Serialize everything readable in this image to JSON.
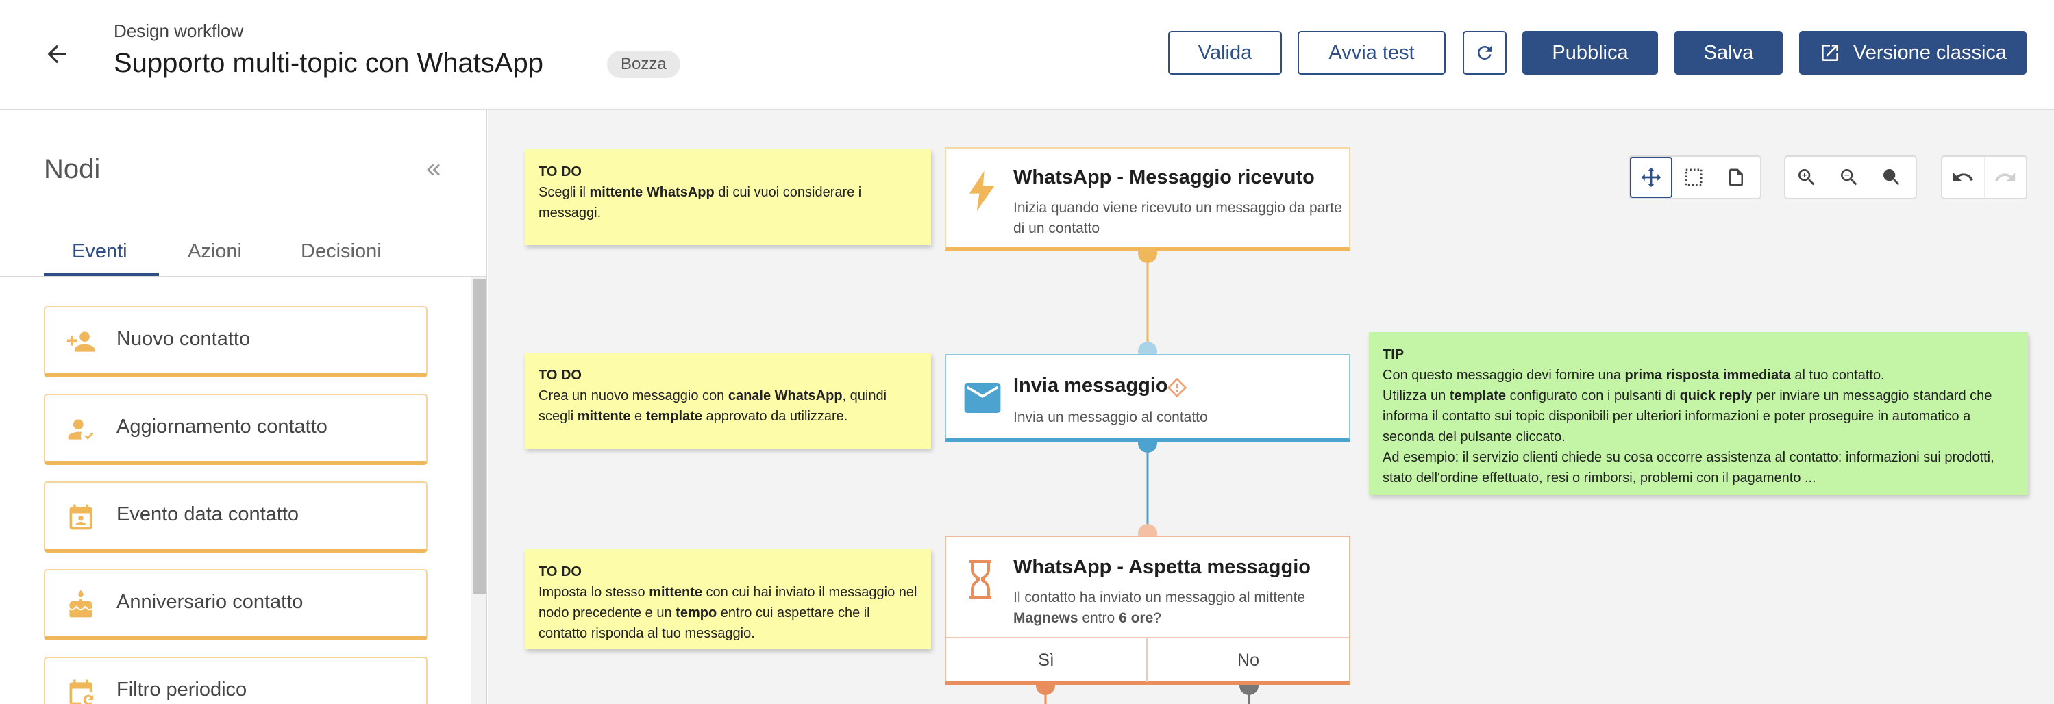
{
  "header": {
    "subtitle": "Design workflow",
    "title": "Supporto multi-topic con WhatsApp",
    "badge": "Bozza",
    "buttons": {
      "validate": "Valida",
      "start_test": "Avvia test",
      "publish": "Pubblica",
      "save": "Salva",
      "classic_version": "Versione classica"
    }
  },
  "sidebar": {
    "title": "Nodi",
    "tabs": [
      "Eventi",
      "Azioni",
      "Decisioni"
    ],
    "active_tab": "Eventi",
    "items": [
      {
        "label": "Nuovo contatto",
        "icon": "person-add-icon"
      },
      {
        "label": "Aggiornamento contatto",
        "icon": "person-check-icon"
      },
      {
        "label": "Evento data contatto",
        "icon": "calendar-person-icon"
      },
      {
        "label": "Anniversario contatto",
        "icon": "cake-icon"
      },
      {
        "label": "Filtro periodico",
        "icon": "calendar-refresh-icon"
      }
    ]
  },
  "canvas": {
    "notes": [
      {
        "title": "TO DO",
        "parts": [
          [
            "Scegli il ",
            false
          ],
          [
            "mittente WhatsApp",
            true
          ],
          [
            " di cui vuoi considerare i messaggi.",
            false
          ]
        ]
      },
      {
        "title": "TO DO",
        "parts": [
          [
            "Crea un nuovo messaggio con ",
            false
          ],
          [
            "canale WhatsApp",
            true
          ],
          [
            ", quindi scegli ",
            false
          ],
          [
            "mittente",
            true
          ],
          [
            " e ",
            false
          ],
          [
            "template",
            true
          ],
          [
            " approvato da utilizzare.",
            false
          ]
        ]
      },
      {
        "title": "TO DO",
        "parts": [
          [
            "Imposta lo stesso ",
            false
          ],
          [
            "mittente",
            true
          ],
          [
            " con cui hai inviato il messaggio nel nodo precedente e un ",
            false
          ],
          [
            "tempo",
            true
          ],
          [
            " entro cui aspettare che il contatto risponda al tuo messaggio.",
            false
          ]
        ]
      },
      {
        "title": "TIP",
        "parts": [
          [
            "Con questo messaggio devi fornire una ",
            false
          ],
          [
            "prima risposta immediata",
            true
          ],
          [
            " al tuo contatto.\nUtilizza un ",
            false
          ],
          [
            "template",
            true
          ],
          [
            " configurato con i pulsanti di ",
            false
          ],
          [
            "quick reply",
            true
          ],
          [
            " per inviare un messaggio standard che informa il contatto sui topic disponibili per ulteriori informazioni e poter proseguire in automatico a seconda del pulsante cliccato.\nAd esempio: il servizio clienti chiede su cosa occorre assistenza al contatto: informazioni sui prodotti, stato dell'ordine effettuato, resi o rimborsi, problemi con il pagamento ...",
            false
          ]
        ]
      }
    ],
    "nodes": {
      "received": {
        "title": "WhatsApp - Messaggio ricevuto",
        "desc": "Inizia quando viene ricevuto un messaggio da parte di un contatto",
        "icon": "lightning-icon",
        "color": "#f0b75a"
      },
      "send": {
        "title": "Invia messaggio",
        "desc": "Invia un messaggio al contatto",
        "icon": "envelope-icon",
        "color": "#4ca3cf"
      },
      "wait": {
        "title": "WhatsApp - Aspetta messaggio",
        "desc_parts": [
          [
            "Il contatto ha inviato un messaggio al mittente ",
            false
          ],
          [
            "Magnews",
            true
          ],
          [
            " entro ",
            false
          ],
          [
            "6 ore",
            true
          ],
          [
            "?",
            false
          ]
        ],
        "icon": "hourglass-icon",
        "color": "#e78e5c",
        "branch_yes": "Sì",
        "branch_no": "No"
      }
    },
    "colors": {
      "event": "#f0b75a",
      "action": "#4ca3cf",
      "decision": "#e78e5c",
      "no_branch": "#777777",
      "accent": "#2e4e86"
    }
  }
}
